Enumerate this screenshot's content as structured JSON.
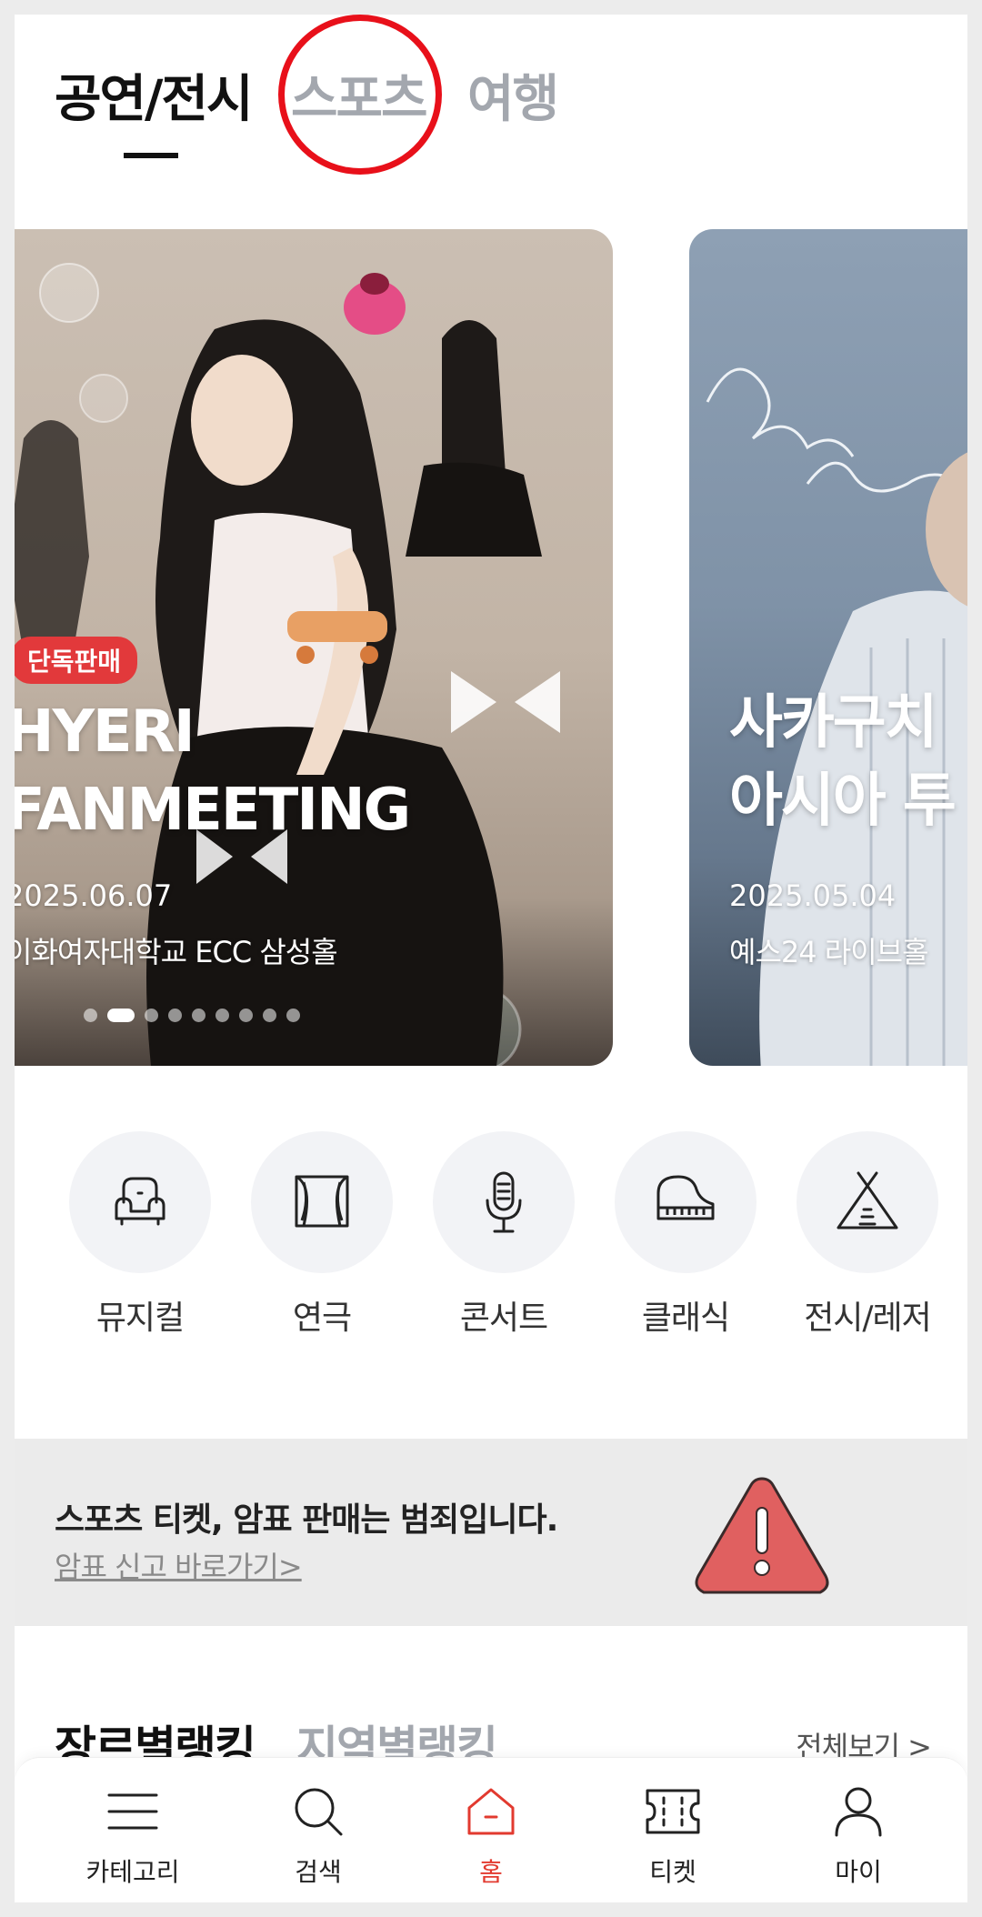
{
  "tabs": [
    "공연/전시",
    "스포츠",
    "여행"
  ],
  "carousel": [
    {
      "badge": "단독판매",
      "title_line1": "HYERI",
      "title_line2": "FANMEETING",
      "date": "2025.06.07",
      "venue": "이화여자대학교 ECC 삼성홀"
    },
    {
      "title_line1": "사카구치",
      "title_line2": "아시아 투",
      "date": "2025.05.04",
      "venue": "예스24 라이브홀"
    }
  ],
  "carousel_position": {
    "current": 2,
    "total": 9
  },
  "categories": [
    {
      "label": "뮤지컬",
      "icon": "armchair-icon"
    },
    {
      "label": "연극",
      "icon": "theater-curtain-icon"
    },
    {
      "label": "콘서트",
      "icon": "microphone-icon"
    },
    {
      "label": "클래식",
      "icon": "piano-icon"
    },
    {
      "label": "전시/레저",
      "icon": "tent-icon"
    }
  ],
  "notice": {
    "title": "스포츠 티켓, 암표 판매는 범죄입니다.",
    "link": "암표 신고 바로가기>"
  },
  "ranking": {
    "tab_active": "장르별랭킹",
    "tab_inactive": "지역별랭킹",
    "see_all": "전체보기 >"
  },
  "bottom_nav": [
    {
      "label": "카테고리",
      "icon": "menu-icon"
    },
    {
      "label": "검색",
      "icon": "search-icon"
    },
    {
      "label": "홈",
      "icon": "home-icon",
      "active": true
    },
    {
      "label": "티켓",
      "icon": "ticket-icon"
    },
    {
      "label": "마이",
      "icon": "user-icon"
    }
  ],
  "colors": {
    "accent_red": "#e23a2f",
    "badge_red": "#e2393b",
    "inactive_gray": "#a3a7ae",
    "warning_red": "#e06060"
  }
}
